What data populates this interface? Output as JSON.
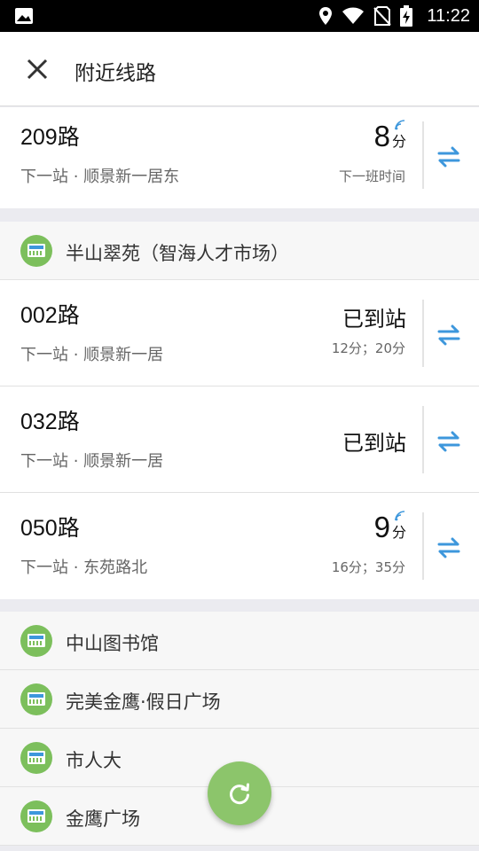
{
  "status_bar": {
    "time": "11:22"
  },
  "header": {
    "title": "附近线路"
  },
  "top_route": {
    "name": "209路",
    "next_stop": "下一站 · 顺景新一居东",
    "eta_value": "8",
    "eta_unit": "分",
    "eta_caption": "下一班时间"
  },
  "group1": {
    "station_name": "半山翠苑（智海人才市场）",
    "routes": [
      {
        "name": "002路",
        "next_stop": "下一站 · 顺景新一居",
        "status": "已到站",
        "sub": "12分；20分"
      },
      {
        "name": "032路",
        "next_stop": "下一站 · 顺景新一居",
        "status": "已到站",
        "sub": ""
      },
      {
        "name": "050路",
        "next_stop": "下一站 · 东苑路北",
        "eta_value": "9",
        "eta_unit": "分",
        "sub": "16分；35分"
      }
    ]
  },
  "stations": [
    {
      "name": "中山图书馆"
    },
    {
      "name": "完美金鹰·假日广场"
    },
    {
      "name": "市人大"
    },
    {
      "name": "金鹰广场"
    }
  ],
  "colors": {
    "accent_blue": "#3d97dc",
    "fab_green": "#8cc56b",
    "station_icon_green": "#7cbf5c"
  },
  "icons": {
    "close": "close-icon",
    "swap": "swap-arrows-icon",
    "refresh": "refresh-icon",
    "bus_stop": "bus-stop-icon"
  }
}
